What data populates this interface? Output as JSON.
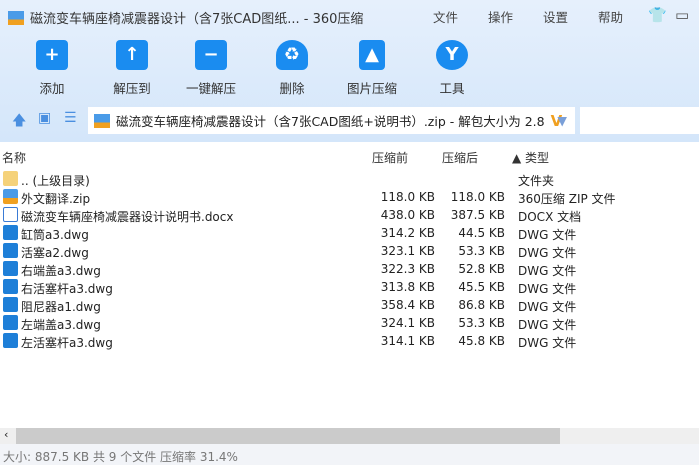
{
  "window": {
    "title": "磁流变车辆座椅减震器设计（含7张CAD图纸... - 360压缩"
  },
  "menu": [
    "文件",
    "操作",
    "设置",
    "帮助"
  ],
  "toolbar": [
    {
      "label": "添加",
      "icon": "+"
    },
    {
      "label": "解压到",
      "icon": "↑"
    },
    {
      "label": "一键解压",
      "icon": "−"
    },
    {
      "label": "删除",
      "icon": "♻"
    },
    {
      "label": "图片压缩",
      "icon": "▲"
    },
    {
      "label": "工具",
      "icon": "Y"
    }
  ],
  "address": {
    "path": "磁流变车辆座椅减震器设计（含7张CAD图纸+说明书）.zip - 解包大小为 2.8",
    "badge": "V"
  },
  "columns": {
    "name": "名称",
    "before": "压缩前",
    "after": "压缩后",
    "type": "▲ 类型"
  },
  "files": [
    {
      "name": ".. (上级目录)",
      "before": "",
      "after": "",
      "type": "文件夹",
      "kind": "folder"
    },
    {
      "name": "外文翻译.zip",
      "before": "118.0 KB",
      "after": "118.0 KB",
      "type": "360压缩 ZIP 文件",
      "kind": "zip"
    },
    {
      "name": "磁流变车辆座椅减震器设计说明书.docx",
      "before": "438.0 KB",
      "after": "387.5 KB",
      "type": "DOCX 文档",
      "kind": "docx"
    },
    {
      "name": "缸筒a3.dwg",
      "before": "314.2 KB",
      "after": "44.5 KB",
      "type": "DWG 文件",
      "kind": "dwg"
    },
    {
      "name": "活塞a2.dwg",
      "before": "323.1 KB",
      "after": "53.3 KB",
      "type": "DWG 文件",
      "kind": "dwg"
    },
    {
      "name": "右端盖a3.dwg",
      "before": "322.3 KB",
      "after": "52.8 KB",
      "type": "DWG 文件",
      "kind": "dwg"
    },
    {
      "name": "右活塞杆a3.dwg",
      "before": "313.8 KB",
      "after": "45.5 KB",
      "type": "DWG 文件",
      "kind": "dwg"
    },
    {
      "name": "阻尼器a1.dwg",
      "before": "358.4 KB",
      "after": "86.8 KB",
      "type": "DWG 文件",
      "kind": "dwg"
    },
    {
      "name": "左端盖a3.dwg",
      "before": "324.1 KB",
      "after": "53.3 KB",
      "type": "DWG 文件",
      "kind": "dwg"
    },
    {
      "name": "左活塞杆a3.dwg",
      "before": "314.1 KB",
      "after": "45.8 KB",
      "type": "DWG 文件",
      "kind": "dwg"
    }
  ],
  "status": "大小: 887.5 KB 共 9 个文件 压缩率 31.4%"
}
